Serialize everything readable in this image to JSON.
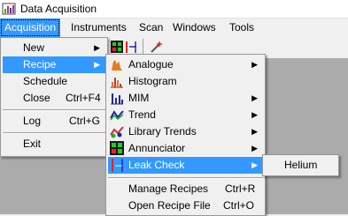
{
  "window": {
    "title": "Data Acquisition"
  },
  "menubar": {
    "items": [
      {
        "label": "Acquisition",
        "active": true
      },
      {
        "label": "Instruments"
      },
      {
        "label": "Scan"
      },
      {
        "label": "Windows"
      },
      {
        "label": "Tools"
      }
    ]
  },
  "acquisition_menu": {
    "new_label": "New",
    "recipe_label": "Recipe",
    "schedule_label": "Schedule",
    "close_label": "Close",
    "close_shortcut": "Ctrl+F4",
    "log_label": "Log",
    "log_shortcut": "Ctrl+G",
    "exit_label": "Exit"
  },
  "recipe_menu": {
    "items": [
      {
        "label": "Analogue",
        "icon": "analogue-icon",
        "submenu": true
      },
      {
        "label": "Histogram",
        "icon": "histogram-icon",
        "submenu": false
      },
      {
        "label": "MIM",
        "icon": "mim-icon",
        "submenu": true
      },
      {
        "label": "Trend",
        "icon": "trend-icon",
        "submenu": true
      },
      {
        "label": "Library Trends",
        "icon": "library-trends-icon",
        "submenu": true
      },
      {
        "label": "Annunciator",
        "icon": "annunciator-icon",
        "submenu": true
      },
      {
        "label": "Leak Check",
        "icon": "leak-check-icon",
        "submenu": true,
        "highlighted": true
      }
    ],
    "manage_label": "Manage Recipes",
    "manage_shortcut": "Ctrl+R",
    "open_label": "Open Recipe File",
    "open_shortcut": "Ctrl+O"
  },
  "leak_check_menu": {
    "helium_label": "Helium"
  },
  "colors": {
    "highlight": "#3399ff",
    "menu_bg": "#f0f0f0",
    "workspace": "#ababab"
  }
}
